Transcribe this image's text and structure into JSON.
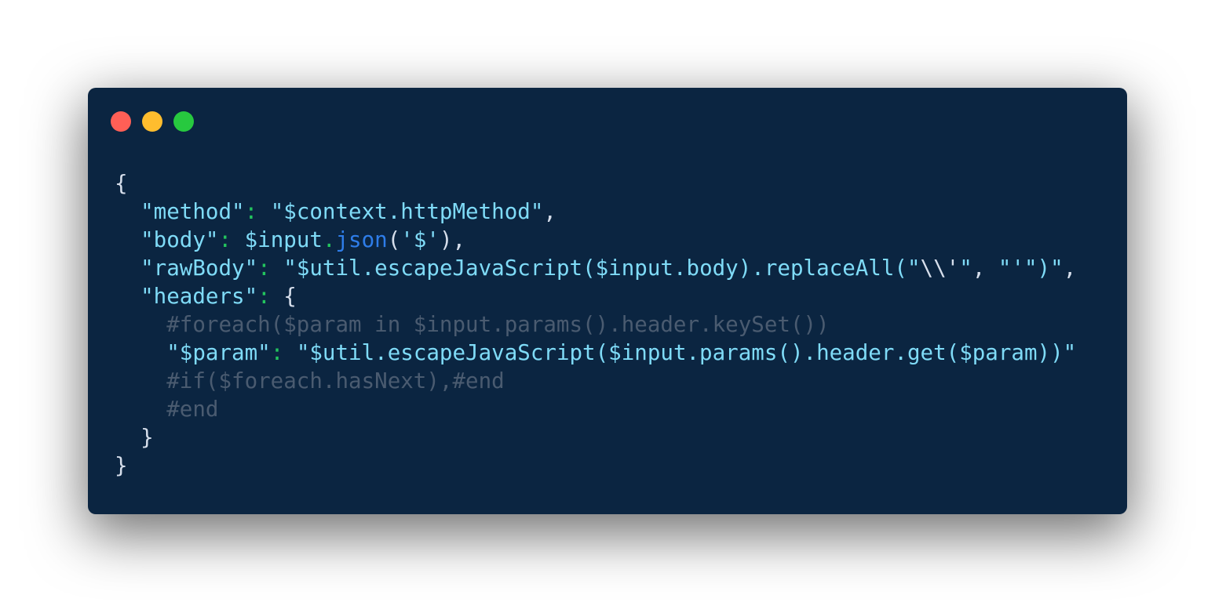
{
  "colors": {
    "background": "#0b2541",
    "close": "#ff5f56",
    "minimize": "#ffbd2e",
    "zoom": "#27c93f",
    "punctuation": "#d6deeb",
    "string": "#7fdbf7",
    "colon": "#23c55e",
    "method": "#2e7de9",
    "comment": "#4a5b70"
  },
  "window": {
    "controls": [
      {
        "name": "close-button",
        "color": "close"
      },
      {
        "name": "minimize-button",
        "color": "minimize"
      },
      {
        "name": "zoom-button",
        "color": "zoom"
      }
    ]
  },
  "code": {
    "lines": [
      {
        "name": "open-brace",
        "tokens": [
          {
            "text": "{",
            "color": "punctuation"
          }
        ]
      },
      {
        "name": "method-line",
        "tokens": [
          {
            "text": "  ",
            "color": "punctuation"
          },
          {
            "text": "\"method\"",
            "color": "string"
          },
          {
            "text": ": ",
            "color": "colon"
          },
          {
            "text": "\"$context.httpMethod\"",
            "color": "string"
          },
          {
            "text": ",",
            "color": "punctuation"
          }
        ]
      },
      {
        "name": "body-line",
        "tokens": [
          {
            "text": "  ",
            "color": "punctuation"
          },
          {
            "text": "\"body\"",
            "color": "string"
          },
          {
            "text": ": ",
            "color": "colon"
          },
          {
            "text": "$input",
            "color": "string"
          },
          {
            "text": ".",
            "color": "colon"
          },
          {
            "text": "json",
            "color": "method"
          },
          {
            "text": "(",
            "color": "punctuation"
          },
          {
            "text": "'$'",
            "color": "string"
          },
          {
            "text": "),",
            "color": "punctuation"
          }
        ]
      },
      {
        "name": "raw-body-line",
        "tokens": [
          {
            "text": "  ",
            "color": "punctuation"
          },
          {
            "text": "\"rawBody\"",
            "color": "string"
          },
          {
            "text": ": ",
            "color": "colon"
          },
          {
            "text": "\"$util.escapeJavaScript($input.body).replaceAll(\"",
            "color": "string"
          },
          {
            "text": "\\\\'",
            "color": "punctuation"
          },
          {
            "text": "\"",
            "color": "string"
          },
          {
            "text": ", ",
            "color": "punctuation"
          },
          {
            "text": "\"'\")\"",
            "color": "string"
          },
          {
            "text": ",",
            "color": "punctuation"
          }
        ]
      },
      {
        "name": "headers-line",
        "tokens": [
          {
            "text": "  ",
            "color": "punctuation"
          },
          {
            "text": "\"headers\"",
            "color": "string"
          },
          {
            "text": ": ",
            "color": "colon"
          },
          {
            "text": "{",
            "color": "punctuation"
          }
        ]
      },
      {
        "name": "foreach-line",
        "tokens": [
          {
            "text": "    ",
            "color": "comment"
          },
          {
            "text": "#foreach($param in $input.params().header.keySet())",
            "color": "comment"
          }
        ]
      },
      {
        "name": "param-line",
        "tokens": [
          {
            "text": "    ",
            "color": "punctuation"
          },
          {
            "text": "\"$param\"",
            "color": "string"
          },
          {
            "text": ": ",
            "color": "colon"
          },
          {
            "text": "\"$util.escapeJavaScript($input.params().header.get($param))\"",
            "color": "string"
          }
        ]
      },
      {
        "name": "if-line",
        "tokens": [
          {
            "text": "    ",
            "color": "comment"
          },
          {
            "text": "#if($foreach.hasNext),#end",
            "color": "comment"
          }
        ]
      },
      {
        "name": "end-line",
        "tokens": [
          {
            "text": "    ",
            "color": "comment"
          },
          {
            "text": "#end",
            "color": "comment"
          }
        ]
      },
      {
        "name": "headers-close-line",
        "tokens": [
          {
            "text": "  ",
            "color": "punctuation"
          },
          {
            "text": "}",
            "color": "punctuation"
          }
        ]
      },
      {
        "name": "close-brace",
        "tokens": [
          {
            "text": "}",
            "color": "punctuation"
          }
        ]
      }
    ]
  }
}
